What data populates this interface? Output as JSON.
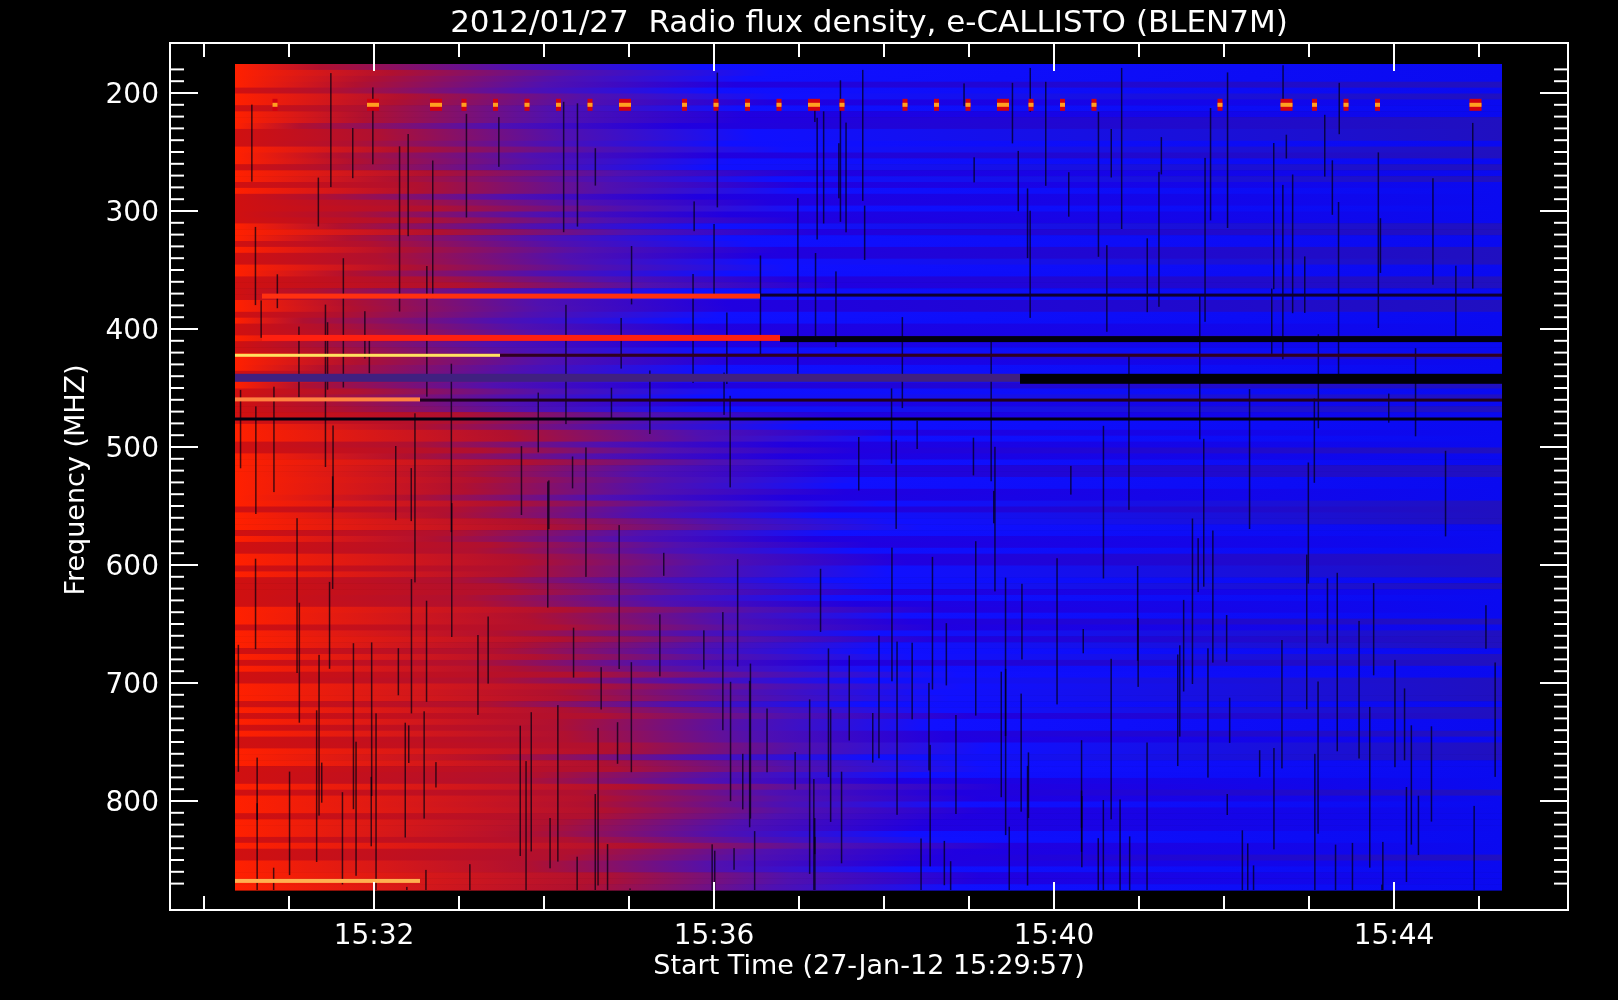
{
  "title": "2012/01/27  Radio flux density, e-CALLISTO (BLEN7M)",
  "y_axis": {
    "label": "Frequency (MHZ)",
    "ticks": [
      "200",
      "300",
      "400",
      "500",
      "600",
      "700",
      "800"
    ]
  },
  "x_axis": {
    "label": "Start Time (27-Jan-12 15:29:57)",
    "ticks": [
      "15:32",
      "15:36",
      "15:40",
      "15:44"
    ]
  }
}
